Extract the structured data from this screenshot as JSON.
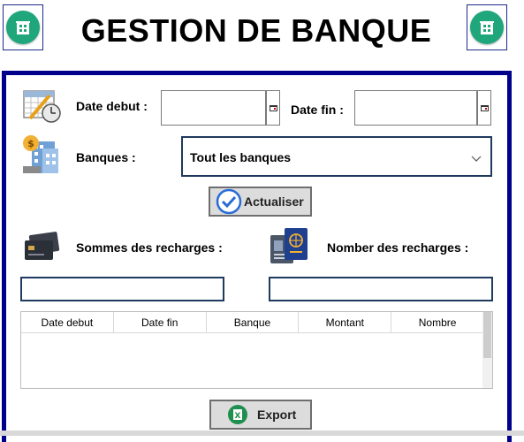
{
  "header": {
    "title": "GESTION DE BANQUE",
    "left_logo_icon": "building-icon",
    "right_logo_icon": "building-icon",
    "logo_color": "#1fa67a"
  },
  "filters": {
    "date_debut_label": "Date debut :",
    "date_debut_value": "",
    "date_fin_label": "Date fin :",
    "date_fin_value": "",
    "banques_label": "Banques :",
    "banques_selected": "Tout les banques"
  },
  "actions": {
    "refresh_label": "Actualiser",
    "export_label": "Export"
  },
  "summary": {
    "sommes_label": "Sommes des recharges :",
    "sommes_value": "",
    "nombre_label": "Nomber des recharges :",
    "nombre_value": ""
  },
  "table": {
    "columns": [
      "Date debut",
      "Date fin",
      "Banque",
      "Montant",
      "Nombre"
    ],
    "rows": []
  },
  "colors": {
    "frame_border": "#00008b",
    "field_border": "#1f3a5f",
    "button_bg": "#dcdcdc"
  }
}
